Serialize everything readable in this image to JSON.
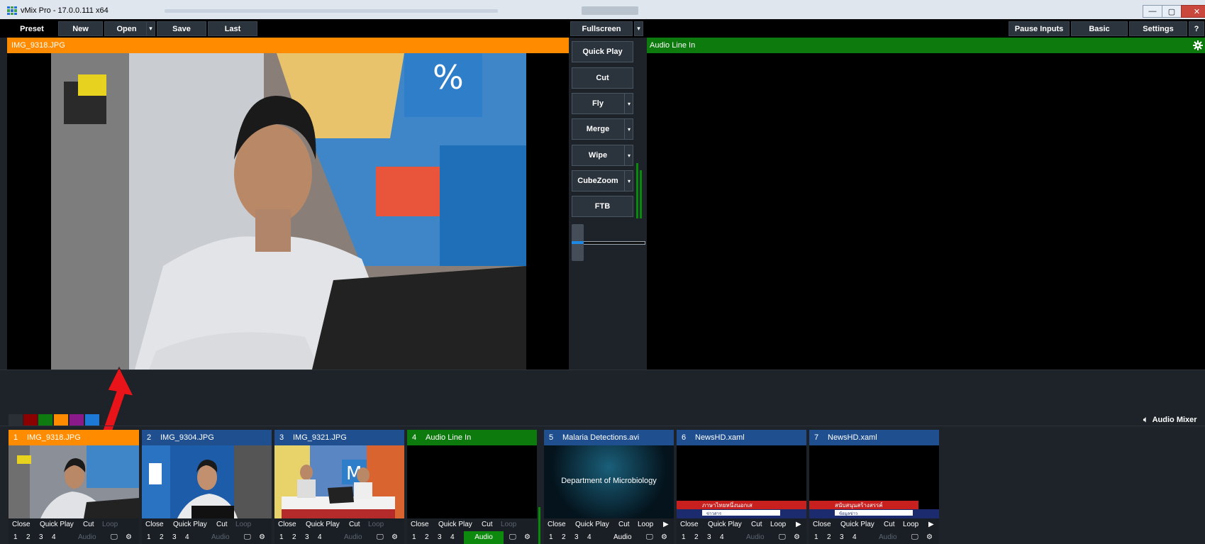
{
  "window": {
    "title": "vMix Pro - 17.0.0.111 x64"
  },
  "toolbar": {
    "preset": "Preset",
    "new": "New",
    "open": "Open",
    "save": "Save",
    "last": "Last",
    "fullscreen": "Fullscreen",
    "pause_inputs": "Pause Inputs",
    "basic": "Basic",
    "settings": "Settings",
    "help": "?"
  },
  "preview": {
    "title": "IMG_9318.JPG"
  },
  "output": {
    "title": "Audio Line In"
  },
  "transitions": {
    "quick_play": "Quick Play",
    "cut": "Cut",
    "fly": "Fly",
    "merge": "Merge",
    "wipe": "Wipe",
    "cubezoom": "CubeZoom",
    "ftb": "FTB"
  },
  "audio_mixer": {
    "label": "Audio Mixer"
  },
  "color_swatches": [
    "#2a2f36",
    "#8b0000",
    "#0f7a0f",
    "#ff8c00",
    "#8a1a8a",
    "#1e78d6"
  ],
  "inputs": [
    {
      "number": "1",
      "title": "IMG_9318.JPG",
      "header_color": "#ff8c00"
    },
    {
      "number": "2",
      "title": "IMG_9304.JPG",
      "header_color": "#1f4f8f"
    },
    {
      "number": "3",
      "title": "IMG_9321.JPG",
      "header_color": "#1f4f8f"
    },
    {
      "number": "4",
      "title": "Audio Line In",
      "header_color": "#0d7a0d"
    },
    {
      "number": "5",
      "title": "Malaria Detections.avi",
      "header_color": "#1f4f8f",
      "thumb_text": "Department of Microbiology"
    },
    {
      "number": "6",
      "title": "NewsHD.xaml",
      "header_color": "#1f4f8f",
      "ticker": "ภาษาไทยหนึ่งนอกเส",
      "ticker_sub": "ข่าวสาร"
    },
    {
      "number": "7",
      "title": "NewsHD.xaml",
      "header_color": "#1f4f8f",
      "ticker": "สนับสนุนสร้างสรรค์",
      "ticker_sub": "ข้อมูลข่าว"
    }
  ],
  "input_controls": {
    "close": "Close",
    "quick_play": "Quick Play",
    "cut": "Cut",
    "loop": "Loop",
    "audio": "Audio",
    "o1": "1",
    "o2": "2",
    "o3": "3",
    "o4": "4"
  }
}
